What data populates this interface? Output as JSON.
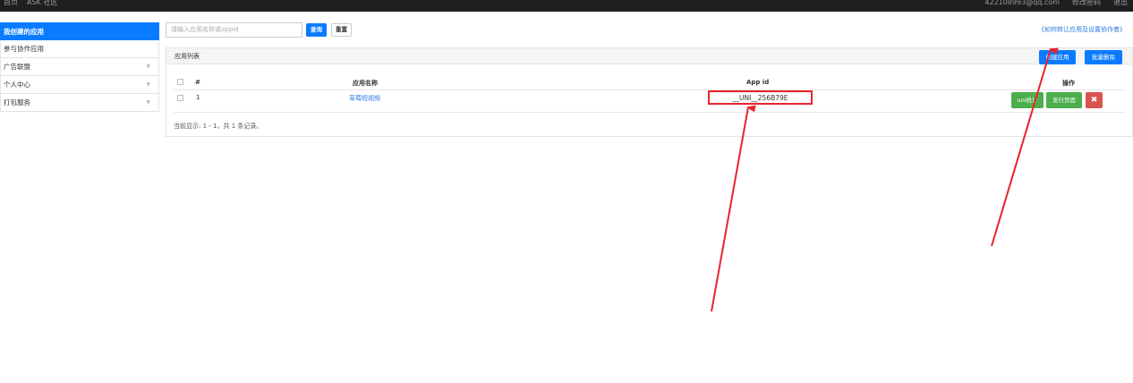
{
  "topbar": {
    "left_items": [
      "首页",
      "ASK 社区"
    ],
    "right_items": [
      "422108993@qq.com",
      "修改密码",
      "退出"
    ]
  },
  "sidebar": {
    "items": [
      {
        "label": "我创建的应用",
        "active": true,
        "has_chevron": false
      },
      {
        "label": "参与协作应用",
        "active": false,
        "has_chevron": false
      },
      {
        "label": "广告联盟",
        "active": false,
        "has_chevron": true
      },
      {
        "label": "个人中心",
        "active": false,
        "has_chevron": true
      },
      {
        "label": "打包服务",
        "active": false,
        "has_chevron": true
      }
    ]
  },
  "search": {
    "placeholder": "请输入应用名称或appid",
    "query_label": "查询",
    "reset_label": "重置"
  },
  "help_link": "《如何转让应用及设置协作者》",
  "panel": {
    "title": "应用列表",
    "create_label": "创建应用",
    "batch_delete_label": "批量删除",
    "columns": {
      "index": "#",
      "name": "应用名称",
      "appid": "App id",
      "ops": "操作"
    },
    "rows": [
      {
        "index": "1",
        "name": "草莓短视频",
        "appid": "__UNI__256B79E",
        "op1": "uni统计",
        "op2": "发行页面",
        "op3": "✖"
      }
    ],
    "footer": "当前显示: 1 - 1，共 1 条记录。"
  },
  "colors": {
    "primary": "#0a7bff",
    "success": "#4cae4c",
    "danger": "#d9534f",
    "highlight": "#e8232b"
  }
}
